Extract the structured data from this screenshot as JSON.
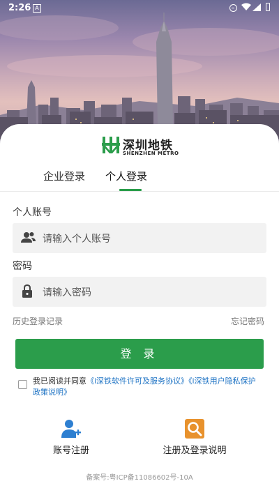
{
  "status_bar": {
    "time": "2:26",
    "notification_letter": "A"
  },
  "brand": {
    "name_cn": "深圳地铁",
    "name_en": "SHENZHEN METRO",
    "color": "#2b9d4b"
  },
  "tabs": [
    {
      "label": "企业登录",
      "active": false
    },
    {
      "label": "个人登录",
      "active": true
    }
  ],
  "form": {
    "account_label": "个人账号",
    "account_placeholder": "请输入个人账号",
    "account_icon": "user-group-icon",
    "password_label": "密码",
    "password_placeholder": "请输入密码",
    "password_icon": "lock-icon",
    "history_link": "历史登录记录",
    "forgot_link": "忘记密码",
    "login_button": "登 录"
  },
  "agreement": {
    "checked": false,
    "prefix": "我已阅读并同意",
    "link1": "《i深铁软件许可及服务协议》",
    "link2": "《i深铁用户隐私保护政策说明》",
    "link_color": "#1e73c4"
  },
  "actions": [
    {
      "label": "账号注册",
      "icon": "add-user-icon",
      "color": "#2d7fd1"
    },
    {
      "label": "注册及登录说明",
      "icon": "magnifier-icon",
      "color": "#e8922d"
    }
  ],
  "footer": {
    "icp": "备案号:粤ICP备11086602号-10A"
  }
}
